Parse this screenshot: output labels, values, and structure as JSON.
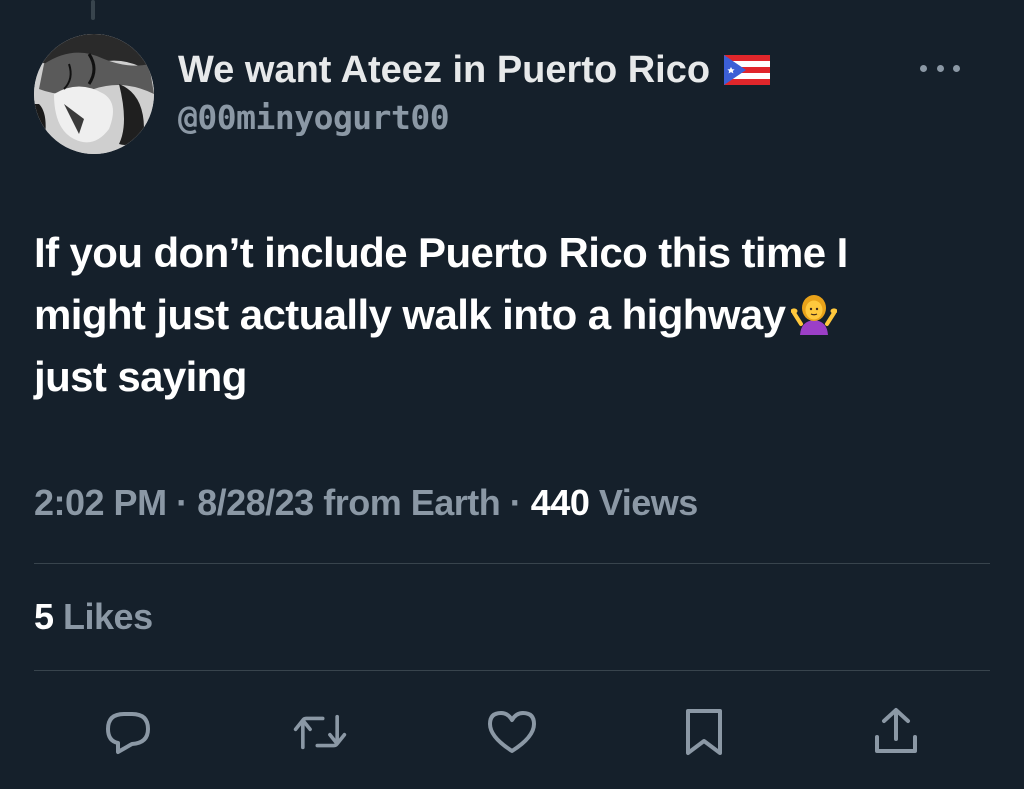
{
  "tweet": {
    "display_name": "We want Ateez in Puerto Rico",
    "handle": "@00minyogurt00",
    "text_line1": "If you don’t include Puerto Rico this time I",
    "text_line2": "might just actually walk into a highway",
    "text_line3": "just saying",
    "time": "2:02 PM",
    "separator": "·",
    "date": "8/28/23",
    "source": "from Earth",
    "views_count": "440",
    "views_label": "Views",
    "likes_count": "5",
    "likes_label": "Likes"
  },
  "icons": {
    "flag": "puerto-rico-flag-icon",
    "emoji": "person-shrugging-icon",
    "more": "more-options-icon",
    "reply": "reply-icon",
    "retweet": "retweet-icon",
    "like": "heart-icon",
    "bookmark": "bookmark-icon",
    "share": "share-icon"
  },
  "colors": {
    "background": "#15202b",
    "text_primary": "#ffffff",
    "text_secondary": "#8b98a5",
    "divider": "#38444d"
  }
}
